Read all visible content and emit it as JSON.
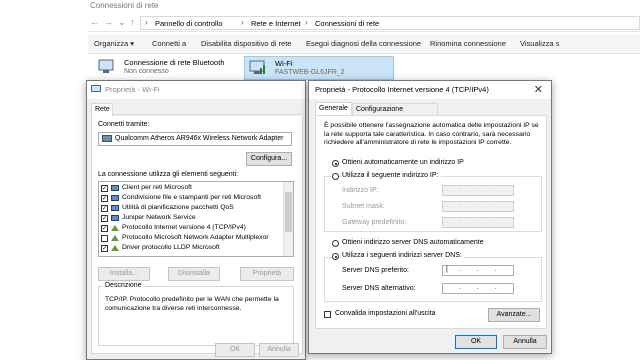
{
  "explorer": {
    "title": "Connessioni di rete",
    "breadcrumb": [
      "Pannello di controllo",
      "Rete e Internet",
      "Connessioni di rete"
    ],
    "toolbar": [
      "Organizza ▾",
      "Connetti a",
      "Disabilita dispositivo di rete",
      "Esegui diagnosi della connessione",
      "Rinomina connessione",
      "Visualizza s"
    ],
    "connections": [
      {
        "name": "Connessione di rete Bluetooth",
        "status": "Non connesso"
      },
      {
        "name": "Wi-Fi",
        "status": "FASTWEB-GL6JFR_2"
      }
    ]
  },
  "wifi_dialog": {
    "title": "Proprietà - Wi-Fi",
    "tab": "Rete",
    "connect_using_label": "Connetti tramite:",
    "adapter": "Qualcomm Atheros AR946x Wireless Network Adapter",
    "configure_button": "Configura...",
    "items_label": "La connessione utilizza gli elementi seguenti:",
    "items": [
      {
        "label": "Client per reti Microsoft",
        "checked": true
      },
      {
        "label": "Condivisione file e stampanti per reti Microsoft",
        "checked": true
      },
      {
        "label": "Utilità di pianificazione pacchetti QoS",
        "checked": true
      },
      {
        "label": "Juniper Network Service",
        "checked": true
      },
      {
        "label": "Protocollo Internet versione 4 (TCP/IPv4)",
        "checked": true
      },
      {
        "label": "Protocollo Microsoft Network Adapter Multiplexor",
        "checked": false
      },
      {
        "label": "Driver protocollo LLDP Microsoft",
        "checked": true
      }
    ],
    "install_button": "Installa...",
    "uninstall_button": "Disinstalla",
    "properties_button": "Proprietà",
    "description_title": "Descrizione",
    "description": "TCP/IP. Protocollo predefinito per le WAN che permette la comunicazione tra diverse reti interconnesse.",
    "ok_button": "OK",
    "cancel_button": "Annulla"
  },
  "ipv4_dialog": {
    "title": "Proprietà - Protocollo Internet versione 4 (TCP/IPv4)",
    "close_glyph": "✕",
    "tabs": [
      "Generale",
      "Configurazione alternativa"
    ],
    "intro": "È possibile ottenere l'assegnazione automatica delle impostazioni IP se la rete supporta tale caratteristica. In caso contrario, sarà necessario richiedere all'amministratore di rete le impostazioni IP corrette.",
    "auto_ip": "Ottieni automaticamente un indirizzo IP",
    "manual_ip": "Utilizza il seguente indirizzo IP:",
    "ip_address_label": "Indirizzo IP:",
    "subnet_label": "Subnet mask:",
    "gateway_label": "Gateway predefinito:",
    "auto_dns": "Ottieni indirizzo server DNS automaticamente",
    "manual_dns": "Utilizza i seguenti indirizzi server DNS:",
    "preferred_dns_label": "Server DNS preferito:",
    "alternate_dns_label": "Server DNS alternativo:",
    "validate_label": "Convalida impostazioni all'uscita",
    "advanced_button": "Avanzate...",
    "ok_button": "OK",
    "cancel_button": "Annulla"
  }
}
